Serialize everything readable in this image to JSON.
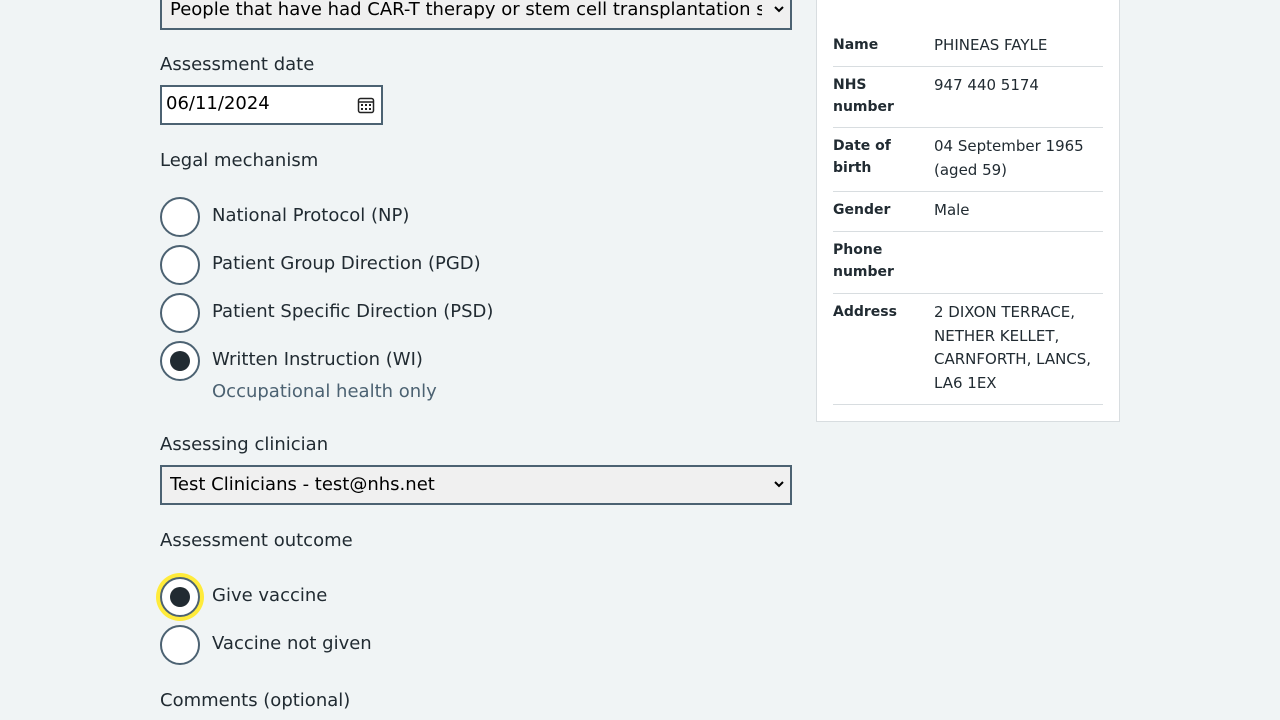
{
  "form": {
    "cohort_select_value": "People that have had CAR-T therapy or stem cell transplantation since their last vaccination",
    "assessment_date_label": "Assessment date",
    "assessment_date_value": "06/11/2024",
    "legal_mechanism_label": "Legal mechanism",
    "legal_mechanism_options": [
      {
        "label": "National Protocol (NP)",
        "selected": false
      },
      {
        "label": "Patient Group Direction (PGD)",
        "selected": false
      },
      {
        "label": "Patient Specific Direction (PSD)",
        "selected": false
      },
      {
        "label": "Written Instruction (WI)",
        "selected": true,
        "hint": "Occupational health only"
      }
    ],
    "assessing_clinician_label": "Assessing clinician",
    "assessing_clinician_value": "Test Clinicians - test@nhs.net",
    "assessment_outcome_label": "Assessment outcome",
    "assessment_outcome_options": [
      {
        "label": "Give vaccine",
        "selected": true
      },
      {
        "label": "Vaccine not given",
        "selected": false
      }
    ],
    "comments_label": "Comments (optional)"
  },
  "patient": {
    "rows": [
      {
        "key": "Name",
        "value": "PHINEAS FAYLE"
      },
      {
        "key": "NHS number",
        "value": "947 440 5174"
      },
      {
        "key": "Date of birth",
        "value": "04 September 1965 (aged 59)"
      },
      {
        "key": "Gender",
        "value": "Male"
      },
      {
        "key": "Phone number",
        "value": ""
      },
      {
        "key": "Address",
        "value": "2 DIXON TERRACE, NETHER KELLET, CARNFORTH, LANCS, LA6 1EX"
      }
    ]
  },
  "colors": {
    "focus": "#ffeb3b",
    "border": "#4c6272",
    "text": "#212b32",
    "hint": "#4c6272"
  }
}
